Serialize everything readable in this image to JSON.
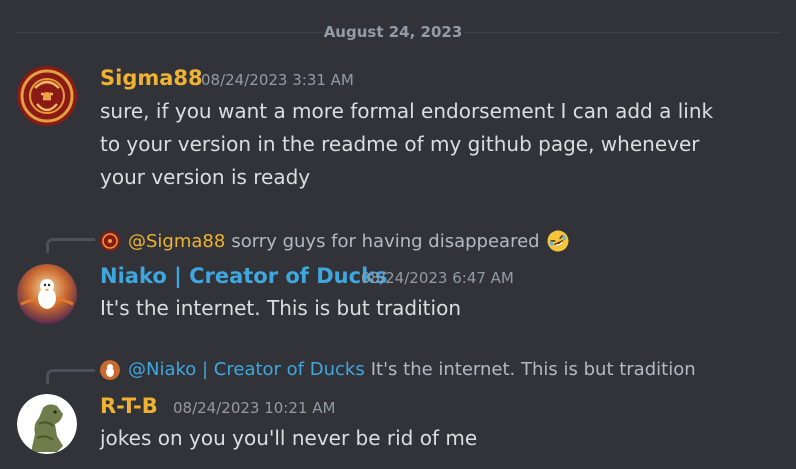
{
  "divider": {
    "date": "August 24, 2023"
  },
  "colors": {
    "background": "#313338",
    "sigma_name": "#f0b232",
    "niako_name": "#3fa7e0",
    "rtb_name": "#f0b232",
    "timestamp": "#949ba4",
    "text": "#dbdee1"
  },
  "messages": [
    {
      "author": "Sigma88",
      "timestamp": "08/24/2023 3:31 AM",
      "lines": [
        "sure, if you want a more formal endorsement I can add a link",
        "to your version in the readme of my github page, whenever",
        "your version is ready"
      ]
    },
    {
      "reply": {
        "mention": "@Sigma88",
        "text": "sorry guys for having disappeared",
        "emoji": "rofl-emoji"
      },
      "author": "Niako | Creator of Ducks",
      "timestamp": "08/24/2023 6:47 AM",
      "lines": [
        "It's the internet. This is but tradition"
      ]
    },
    {
      "reply": {
        "mention": "@Niako | Creator of Ducks",
        "text": "It's the internet. This is but tradition"
      },
      "author": "R-T-B",
      "timestamp": "08/24/2023 10:21 AM",
      "lines": [
        "jokes on you you'll never be rid of me"
      ]
    }
  ]
}
